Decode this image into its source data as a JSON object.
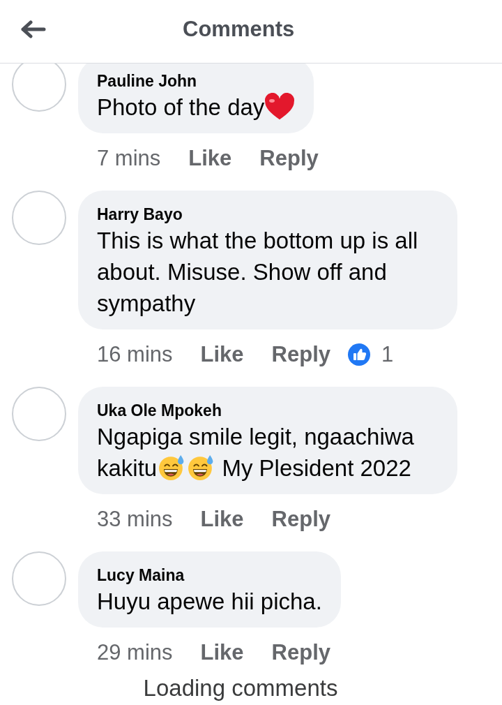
{
  "header": {
    "title": "Comments"
  },
  "comments": [
    {
      "author": "Pauline John",
      "body": [
        {
          "kind": "text",
          "text": "Photo of the day"
        },
        {
          "kind": "heart"
        }
      ],
      "time": "7 mins",
      "actions": [
        "Like",
        "Reply"
      ]
    },
    {
      "author": "Harry Bayo",
      "body": [
        {
          "kind": "text",
          "text": "This is what the bottom up is all about. Misuse. Show off and sympathy"
        }
      ],
      "time": "16 mins",
      "actions": [
        "Like",
        "Reply"
      ],
      "reaction": {
        "kind": "like",
        "count": "1"
      }
    },
    {
      "author": "Uka Ole Mpokeh",
      "body": [
        {
          "kind": "text",
          "text": "Ngapiga smile legit, ngaachiwa kakitu"
        },
        {
          "kind": "sweat-smile"
        },
        {
          "kind": "sweat-smile"
        },
        {
          "kind": "text",
          "text": " My Plesident 2022"
        }
      ],
      "time": "33 mins",
      "actions": [
        "Like",
        "Reply"
      ]
    },
    {
      "author": "Lucy Maina",
      "body": [
        {
          "kind": "text",
          "text": "Huyu apewe hii picha."
        }
      ],
      "time": "29 mins",
      "actions": [
        "Like",
        "Reply"
      ]
    }
  ],
  "footer": {
    "status": "Loading comments"
  }
}
